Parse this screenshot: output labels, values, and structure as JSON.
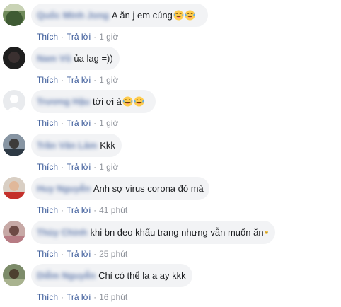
{
  "labels": {
    "like": "Thích",
    "reply": "Trả lời",
    "dot": "·"
  },
  "comments": [
    {
      "name": "Quốc Minh Jong",
      "text": "A ăn j em cúng",
      "emoji_count": 2,
      "time": "1 giờ",
      "avatar": "green-landscape-photo"
    },
    {
      "name": "Nam Vũ",
      "text": "ủa lag =))",
      "emoji_count": 0,
      "time": "1 giờ",
      "avatar": "dark-portrait-photo"
    },
    {
      "name": "Trương Hậu",
      "text": "tời ơi à",
      "emoji_count": 2,
      "time": "1 giờ",
      "avatar": "default-profile-silhouette"
    },
    {
      "name": "Trần Văn Lâm",
      "text": "Kkk",
      "emoji_count": 0,
      "time": "1 giờ",
      "avatar": "outdoor-portrait-photo"
    },
    {
      "name": "Huy Nguyễn",
      "text": "Anh sợ virus corona đó mà",
      "emoji_count": 0,
      "time": "41 phút",
      "avatar": "red-shirt-portrait-photo"
    },
    {
      "name": "Thùy Chinh",
      "text": "khi bn đeo khẩu trang nhưng vẫn muốn ăn",
      "emoji_count": 1,
      "time": "25 phút",
      "avatar": "pink-portrait-photo"
    },
    {
      "name": "Diễm Nguyễn",
      "text": "Chỉ có thể la a ay kkk",
      "emoji_count": 0,
      "time": "16 phút",
      "avatar": "nature-portrait-photo"
    }
  ],
  "colors": {
    "bubble": "#f2f3f5",
    "link": "#385898",
    "meta": "#90949c",
    "text": "#1c1e21",
    "emoji": "#ffcc4d"
  },
  "icons": {
    "emoji": "laughing-crying-emoji"
  }
}
